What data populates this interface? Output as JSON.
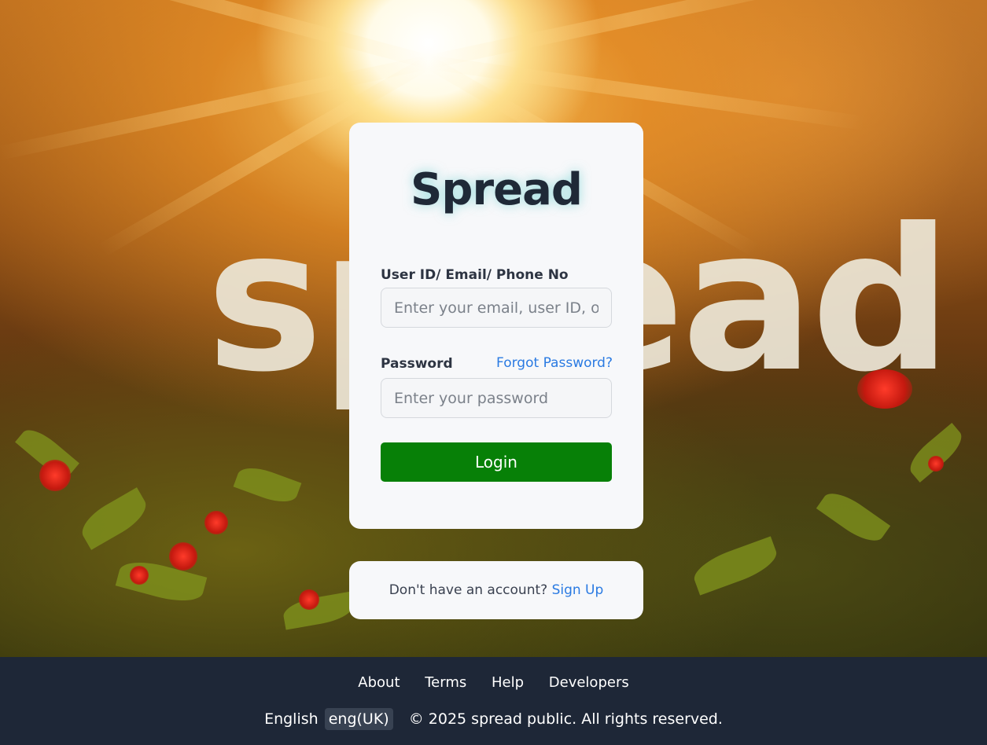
{
  "background": {
    "word": "spread"
  },
  "login_card": {
    "brand": "Spread",
    "user_label": "User ID/ Email/ Phone No",
    "user_placeholder": "Enter your email, user ID, or phone number",
    "password_label": "Password",
    "forgot_link": "Forgot Password?",
    "password_placeholder": "Enter your password",
    "login_button": "Login"
  },
  "signup": {
    "prompt": "Don't have an account?",
    "link": "Sign Up"
  },
  "footer": {
    "links": [
      "About",
      "Terms",
      "Help",
      "Developers"
    ],
    "language_label": "English",
    "language_value": "eng(UK)",
    "copyright": "© 2025 spread public. All rights reserved."
  },
  "colors": {
    "login_button": "#078007",
    "link": "#2a7ae2",
    "footer_bg": "#1e2737",
    "brand_text": "#1f2937"
  }
}
